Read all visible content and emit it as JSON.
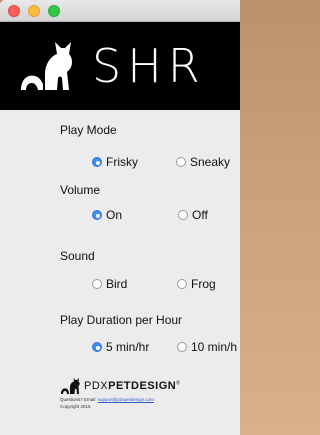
{
  "window": {
    "controls": [
      "close",
      "minimize",
      "zoom"
    ]
  },
  "banner": {
    "title": "SHR",
    "logo_icon": "cat-silhouette-icon"
  },
  "settings": {
    "play_mode": {
      "label": "Play Mode",
      "options": [
        "Frisky",
        "Sneaky"
      ],
      "selected": "Frisky"
    },
    "volume": {
      "label": "Volume",
      "options": [
        "On",
        "Off"
      ],
      "selected": "On"
    },
    "sound": {
      "label": "Sound",
      "options": [
        "Bird",
        "Frog"
      ],
      "selected": null
    },
    "play_duration": {
      "label": "Play Duration per Hour",
      "options": [
        "5 min/hr",
        "10 min/h"
      ],
      "selected": "5 min/hr"
    }
  },
  "footer": {
    "brand_light": "PDX",
    "brand_bold": "PETDESIGN",
    "brand_mark": "®",
    "questions_prefix": "Questions? Email:",
    "email": "support@pdxpetdesign.com",
    "copyright": "Copyright 2015"
  },
  "colors": {
    "accent": "#3f8cf3",
    "banner_bg": "#000000",
    "window_bg": "#ececec"
  }
}
